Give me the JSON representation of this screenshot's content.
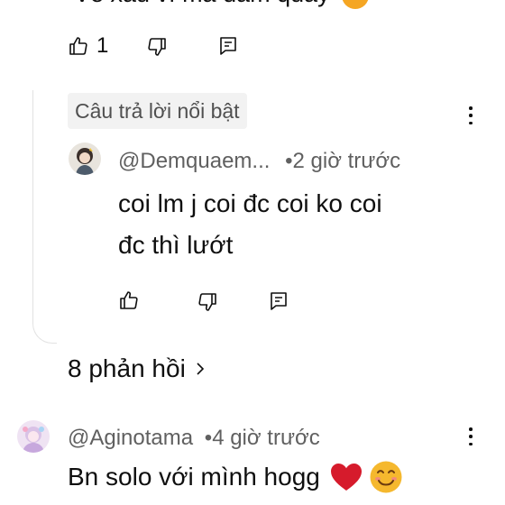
{
  "top_comment": {
    "text_cut": "Về xấu vì mà đám quẩy",
    "like_count": "1"
  },
  "highlighted_label": "Câu trả lời nổi bật",
  "reply": {
    "author": "@Demquaem...",
    "separator": "•",
    "time": "2 giờ trước",
    "text_line1": "coi lm j coi đc coi ko coi",
    "text_line2": "đc thì lướt"
  },
  "more_replies": "8 phản hồi",
  "next_comment": {
    "author": "@Aginotama",
    "separator": "•",
    "time": "4 giờ trước",
    "text": "Bn solo với mình hogg"
  },
  "colors": {
    "text": "#0f0f0f",
    "secondary": "#606060",
    "chip_bg": "#f2f2f2",
    "heart": "#d61b2c",
    "emoji": "#f5b82e"
  },
  "icons": [
    "like-icon",
    "dislike-icon",
    "reply-icon",
    "more-vert-icon",
    "chevron-right-icon"
  ]
}
